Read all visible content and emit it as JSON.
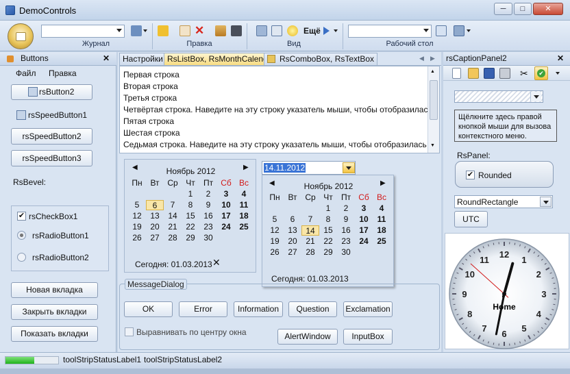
{
  "window": {
    "title": "DemoControls",
    "minimize": "─",
    "maximize": "□",
    "close": "✕"
  },
  "ribbon": {
    "groups": [
      "Журнал",
      "Правка",
      "Вид",
      "Рабочий стол"
    ],
    "more_label": "Ещё"
  },
  "left_panel": {
    "title": "Buttons",
    "menu": [
      "Файл",
      "Правка"
    ],
    "buttons": [
      "rsButton2",
      "rsSpeedButton1",
      "rsSpeedButton2",
      "rsSpeedButton3"
    ],
    "bevel_label": "RsBevel:",
    "checkbox": "rsCheckBox1",
    "radios": [
      "rsRadioButton1",
      "rsRadioButton2"
    ],
    "actions": [
      "Новая вкладка",
      "Закрыть вкладки",
      "Показать вкладки"
    ]
  },
  "tabs": [
    "Настройки",
    "RsListBox, RsMonthCalendar",
    "RsComboBox, RsTextBox"
  ],
  "listbox": {
    "items": [
      "Первая строка",
      "Вторая строка",
      "Третья строка",
      "Четвёртая строка. Наведите на эту строку указатель мыши, чтобы отобразилась в",
      "Пятая строка",
      "Шестая строка",
      "Седьмая строка. Наведите на эту строку указатель мыши, чтобы отобразилась вс"
    ]
  },
  "calendar": {
    "month": "Ноябрь 2012",
    "weekdays": [
      "Пн",
      "Вт",
      "Ср",
      "Чт",
      "Пт",
      "Сб",
      "Вс"
    ],
    "rows": [
      [
        "",
        "",
        "",
        "1",
        "2",
        "3",
        "4"
      ],
      [
        "5",
        "6",
        "7",
        "8",
        "9",
        "10",
        "11"
      ],
      [
        "12",
        "13",
        "14",
        "15",
        "16",
        "17",
        "18"
      ],
      [
        "19",
        "20",
        "21",
        "22",
        "23",
        "24",
        "25"
      ],
      [
        "26",
        "27",
        "28",
        "29",
        "30",
        "",
        ""
      ]
    ],
    "today": "Сегодня: 01.03.2013"
  },
  "datepicker": {
    "value": "14.11.2012",
    "month": "Ноябрь 2012",
    "today": "Сегодня: 01.03.2013"
  },
  "message_dialog": {
    "title": "MessageDialog",
    "buttons": [
      "OK",
      "Error",
      "Information",
      "Question",
      "Exclamation"
    ],
    "checkbox": "Выравнивать по центру окна",
    "alert": "AlertWindow",
    "inputbox": "InputBox"
  },
  "right_panel": {
    "title": "rsCaptionPanel2",
    "hint": [
      "Щёлкните здесь правой",
      "кнопкой мыши для вызова",
      "контекстного меню."
    ],
    "rspanel_label": "RsPanel:",
    "rounded": "Rounded",
    "shape": "RoundRectangle",
    "utc": "UTC",
    "clock_label": "Home",
    "clock_numbers": [
      "12",
      "1",
      "2",
      "3",
      "4",
      "5",
      "6",
      "7",
      "8",
      "9",
      "10",
      "11"
    ],
    "clock_time": {
      "hour": 12,
      "minute": 31,
      "second": 52
    }
  },
  "status": {
    "progress": 0.55,
    "labels": [
      "toolStripStatusLabel1",
      "toolStripStatusLabel2"
    ]
  }
}
